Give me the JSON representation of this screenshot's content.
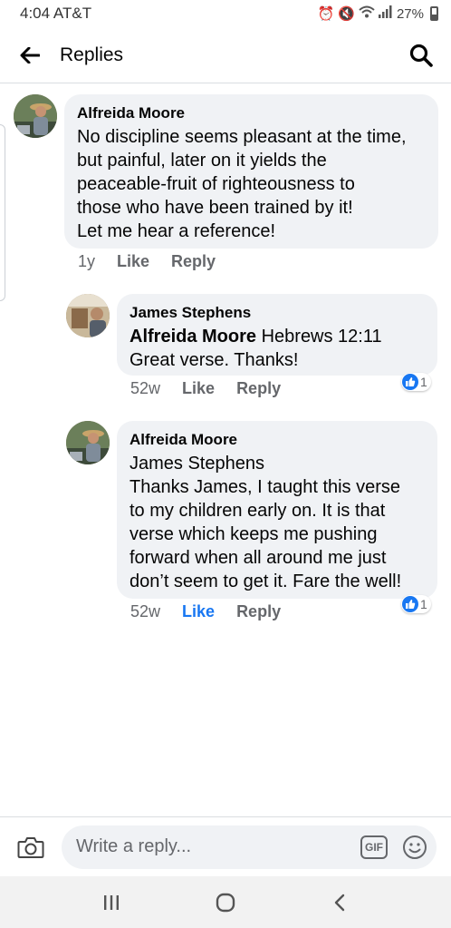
{
  "status_bar": {
    "time": "4:04",
    "carrier": "AT&T",
    "battery": "27%"
  },
  "header": {
    "title": "Replies"
  },
  "comments": [
    {
      "author": "Alfreida Moore",
      "lines": [
        "No discipline seems pleasant at the time,",
        "but painful, later on it yields the",
        "peaceable-fruit of righteousness to",
        "those who have been trained by it!",
        "Let me hear a reference!"
      ],
      "time": "1y",
      "like": "Like",
      "reply": "Reply"
    },
    {
      "author": "James Stephens",
      "mention": "Alfreida Moore",
      "line1_rest": " Hebrews 12:11",
      "line2": "Great verse. Thanks!",
      "time": "52w",
      "like": "Like",
      "reply": "Reply",
      "reaction_count": "1"
    },
    {
      "author": "Alfreida Moore",
      "mention_line": "James Stephens",
      "lines": [
        "Thanks James, I taught this verse",
        "to my children early on. It is that",
        "verse which keeps me pushing",
        "forward when all around me just",
        "don’t seem to get it. Fare the well!"
      ],
      "time": "52w",
      "like": "Like",
      "reply": "Reply",
      "reaction_count": "1",
      "liked_by_viewer": true
    }
  ],
  "composer": {
    "placeholder": "Write a reply...",
    "gif_label": "GIF"
  },
  "colors": {
    "accent": "#1877f2",
    "bubble": "#f0f2f5",
    "secondary_text": "#65676b"
  }
}
